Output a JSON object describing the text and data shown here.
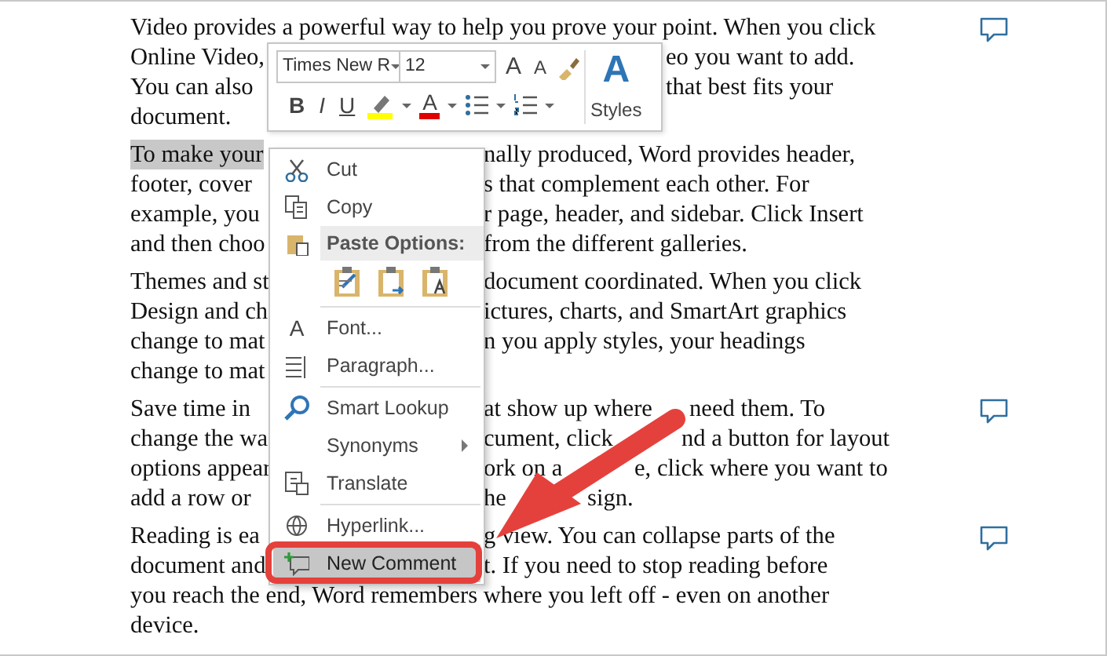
{
  "document": {
    "paragraphs": [
      {
        "comment": true,
        "lines": [
          {
            "left": "Video provides a powerful way to help you prove your point. When you click"
          },
          {
            "left": "Online Video,",
            "right": [
              "eo you want to add."
            ]
          },
          {
            "left": "You can also",
            "right": [
              "that best fits your"
            ]
          },
          {
            "left": "document."
          }
        ]
      },
      {
        "comment": false,
        "lines": [
          {
            "left": "To make your",
            "selected_text": true,
            "right": [
              "nally produced, Word provides header,"
            ]
          },
          {
            "left": "footer, cover",
            "right": [
              "s that complement each other. For"
            ]
          },
          {
            "left": "example, you",
            "right": [
              "r page, header, and sidebar. Click Insert"
            ]
          },
          {
            "left": "and then choo",
            "right": [
              "from the different galleries."
            ]
          }
        ]
      },
      {
        "comment": false,
        "lines": [
          {
            "left": "Themes and st",
            "right": [
              "document coordinated. When you click"
            ]
          },
          {
            "left": "Design and ch",
            "right": [
              "ictures, charts, and SmartArt graphics"
            ]
          },
          {
            "left": "change to mat",
            "right": [
              "n you apply styles, your headings"
            ]
          },
          {
            "left": "change to mat"
          }
        ]
      },
      {
        "comment": true,
        "lines": [
          {
            "left": "Save time in",
            "right": [
              "at show up where",
              "need them. To"
            ]
          },
          {
            "left": "change the wa",
            "right": [
              "cument, click",
              "nd a button for layout"
            ]
          },
          {
            "left": "options appear",
            "right": [
              "ork on a",
              "e, click where you want to"
            ]
          },
          {
            "left": "add a row or",
            "right": [
              "he",
              "sign."
            ]
          }
        ]
      },
      {
        "comment": true,
        "lines": [
          {
            "left": "Reading is ea",
            "right": [
              "g view. You can collapse parts of the"
            ]
          },
          {
            "left": "document and",
            "right": [
              "t. If you need to stop reading before"
            ]
          },
          {
            "left": "you reach the end, Word remembers where you left off - even on another"
          },
          {
            "left": "device."
          }
        ]
      }
    ]
  },
  "mini_toolbar": {
    "font_name": "Times New R",
    "font_size": "12",
    "grow_glyph": "A",
    "shrink_glyph": "A",
    "format_buttons": [
      {
        "kind": "bold",
        "label": "B"
      },
      {
        "kind": "italic",
        "label": "I"
      },
      {
        "kind": "underline",
        "label": "U"
      }
    ],
    "highlight": {
      "color": "#ffff00"
    },
    "font_color": {
      "glyph": "A",
      "color": "#e00000"
    },
    "styles": {
      "glyph": "A",
      "label": "Styles"
    }
  },
  "context_menu": {
    "items": [
      {
        "kind": "item",
        "label": "Cut",
        "selected": false
      },
      {
        "kind": "item",
        "label": "Copy",
        "selected": false
      },
      {
        "kind": "header",
        "label": "Paste Options:"
      },
      {
        "kind": "paste_options"
      },
      {
        "kind": "separator"
      },
      {
        "kind": "item",
        "label": "Font...",
        "glyph": "A",
        "selected": false
      },
      {
        "kind": "item",
        "label": "Paragraph...",
        "selected": false
      },
      {
        "kind": "separator"
      },
      {
        "kind": "item",
        "label": "Smart Lookup",
        "selected": false
      },
      {
        "kind": "item",
        "label": "Synonyms",
        "has_submenu": true,
        "selected": false
      },
      {
        "kind": "item",
        "label": "Translate",
        "selected": false
      },
      {
        "kind": "separator"
      },
      {
        "kind": "item",
        "label": "Hyperlink...",
        "selected": false
      },
      {
        "kind": "item",
        "label": "New Comment",
        "selected": true
      }
    ]
  }
}
